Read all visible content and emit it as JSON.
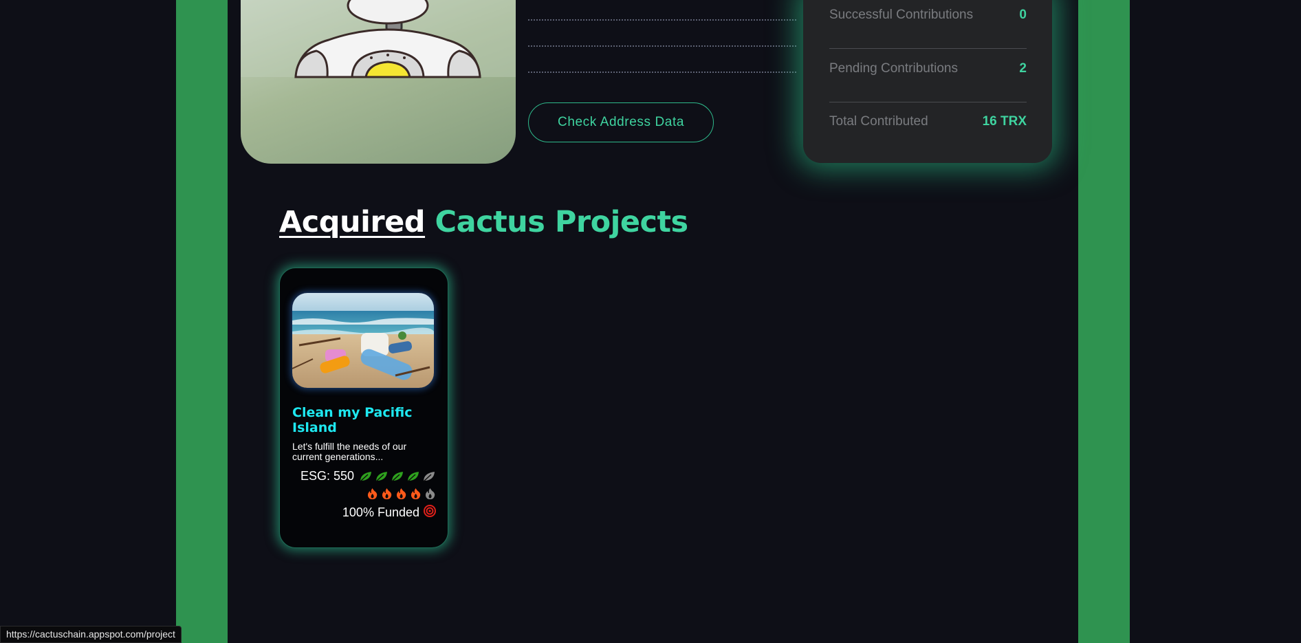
{
  "stats": {
    "rows": [
      {
        "label": "Successful Contributions",
        "value": "0"
      },
      {
        "label": "Pending Contributions",
        "value": "2"
      },
      {
        "label": "Total Contributed",
        "value": "16 TRX"
      }
    ]
  },
  "actions": {
    "check_address": "Check Address Data"
  },
  "section": {
    "title_white": "Acquired",
    "title_green": "Cactus Projects"
  },
  "project": {
    "title": "Clean my Pacific Island",
    "description": "Let's fulfill the needs of our current generations...",
    "esg_label": "ESG: 550",
    "leaf_rating": 4,
    "leaf_max": 5,
    "fire_rating": 4,
    "fire_max": 5,
    "funded": "100% Funded"
  },
  "status_bar": {
    "url": "https://cactuschain.appspot.com/project"
  },
  "colors": {
    "accent": "#3fd4a0",
    "rail": "#2f9350",
    "background": "#0e0f17",
    "title_cyan": "#1ee8f0"
  }
}
